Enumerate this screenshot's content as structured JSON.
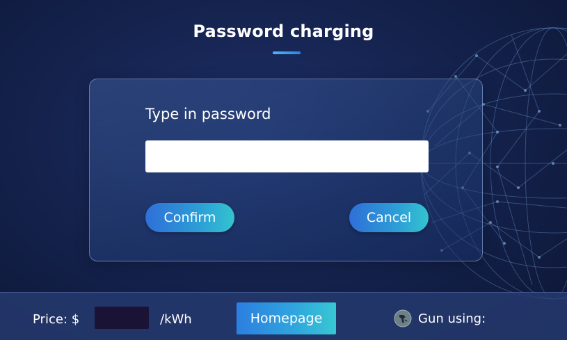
{
  "header": {
    "title": "Password charging"
  },
  "dialog": {
    "prompt": "Type in password",
    "password_value": "",
    "confirm_label": "Confirm",
    "cancel_label": "Cancel"
  },
  "footer": {
    "price_label": "Price: $",
    "price_value": "",
    "unit_label": "/kWh",
    "homepage_label": "Homepage",
    "gun_status_label": "Gun using:",
    "gun_icon": "charging-gun-icon"
  },
  "colors": {
    "background": "#15234f",
    "accent": "#2fa3de",
    "accent_end": "#37c7d3",
    "price_box": "#1a1336"
  }
}
